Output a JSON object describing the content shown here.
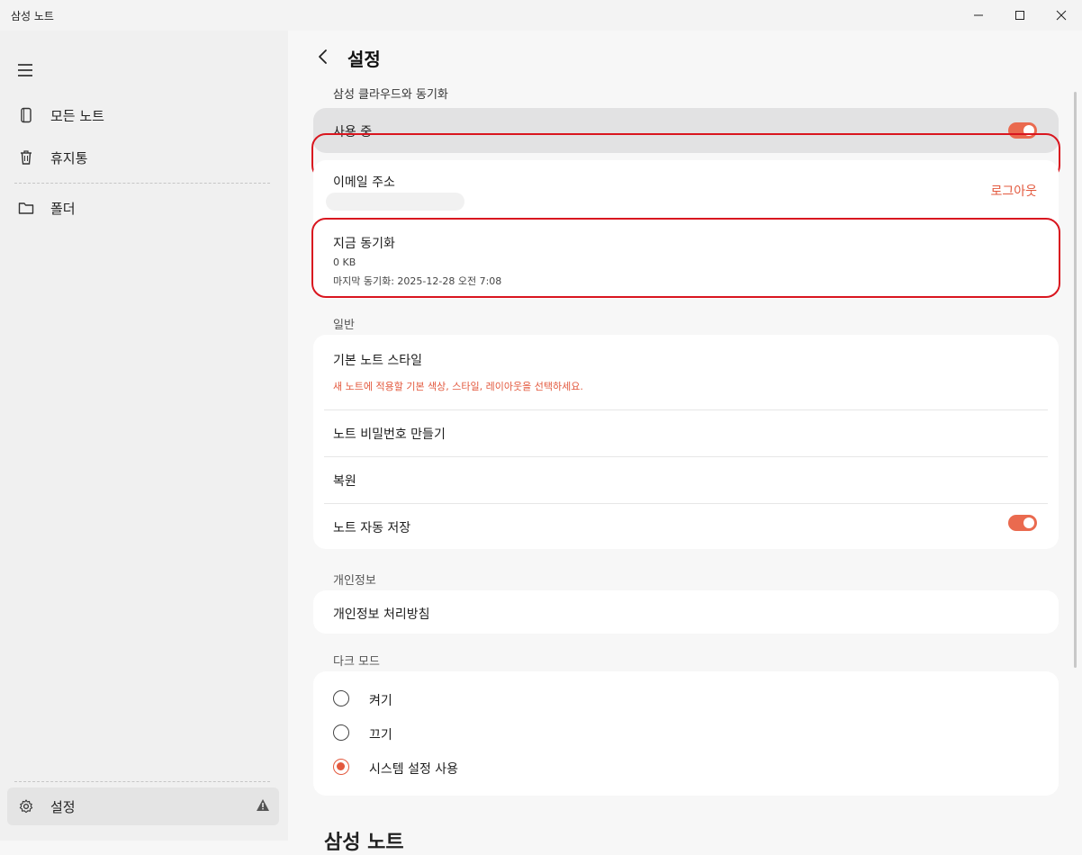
{
  "window": {
    "title": "삼성 노트"
  },
  "sidebar": {
    "items": [
      {
        "label": "모든 노트",
        "icon": "notebook-icon"
      },
      {
        "label": "휴지통",
        "icon": "trash-icon"
      },
      {
        "label": "폴더",
        "icon": "folder-icon"
      }
    ],
    "settings_label": "설정"
  },
  "page": {
    "title": "설정"
  },
  "cloud": {
    "section_label": "삼성 클라우드와 동기화",
    "using_label": "사용 중",
    "using_enabled": true,
    "email_label": "이메일 주소",
    "logout_label": "로그아웃",
    "sync_now_label": "지금 동기화",
    "sync_size": "0 KB",
    "last_sync": "마지막 동기화: 2025-12-28 오전 7:08"
  },
  "general": {
    "section_label": "일반",
    "default_style_label": "기본 노트 스타일",
    "default_style_desc": "새 노트에 적용할 기본 색상, 스타일, 레이아웃을 선택하세요.",
    "password_label": "노트 비밀번호 만들기",
    "restore_label": "복원",
    "autosave_label": "노트 자동 저장",
    "autosave_enabled": true
  },
  "privacy": {
    "section_label": "개인정보",
    "policy_label": "개인정보 처리방침"
  },
  "dark_mode": {
    "section_label": "다크 모드",
    "options": [
      {
        "label": "켜기",
        "selected": false
      },
      {
        "label": "끄기",
        "selected": false
      },
      {
        "label": "시스템 설정 사용",
        "selected": true
      }
    ]
  },
  "footer": {
    "heading": "삼성 노트"
  },
  "colors": {
    "accent": "#e3593e",
    "highlight": "#d9161f"
  }
}
